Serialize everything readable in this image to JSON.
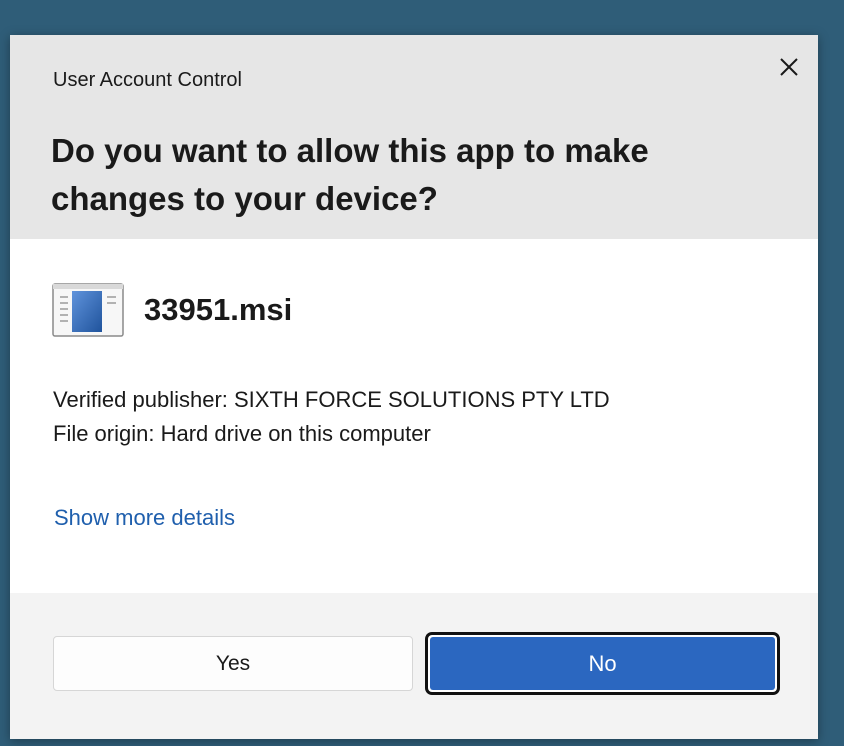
{
  "dialog": {
    "app_title": "User Account Control",
    "question_line1": "Do you want to allow this app to make",
    "question_line2": "changes to your device?",
    "close_icon": "close-icon",
    "app_icon": "installer-window-icon",
    "app_name": "33951.msi",
    "publisher_text": "Verified publisher: SIXTH FORCE SOLUTIONS PTY LTD",
    "origin_text": "File origin: Hard drive on this computer",
    "details_link": "Show more details",
    "yes_label": "Yes",
    "no_label": "No"
  },
  "colors": {
    "desktop_background": "#2f5d78",
    "header_background": "#e6e6e6",
    "accent": "#2b67c0",
    "link": "#1f5fad"
  }
}
